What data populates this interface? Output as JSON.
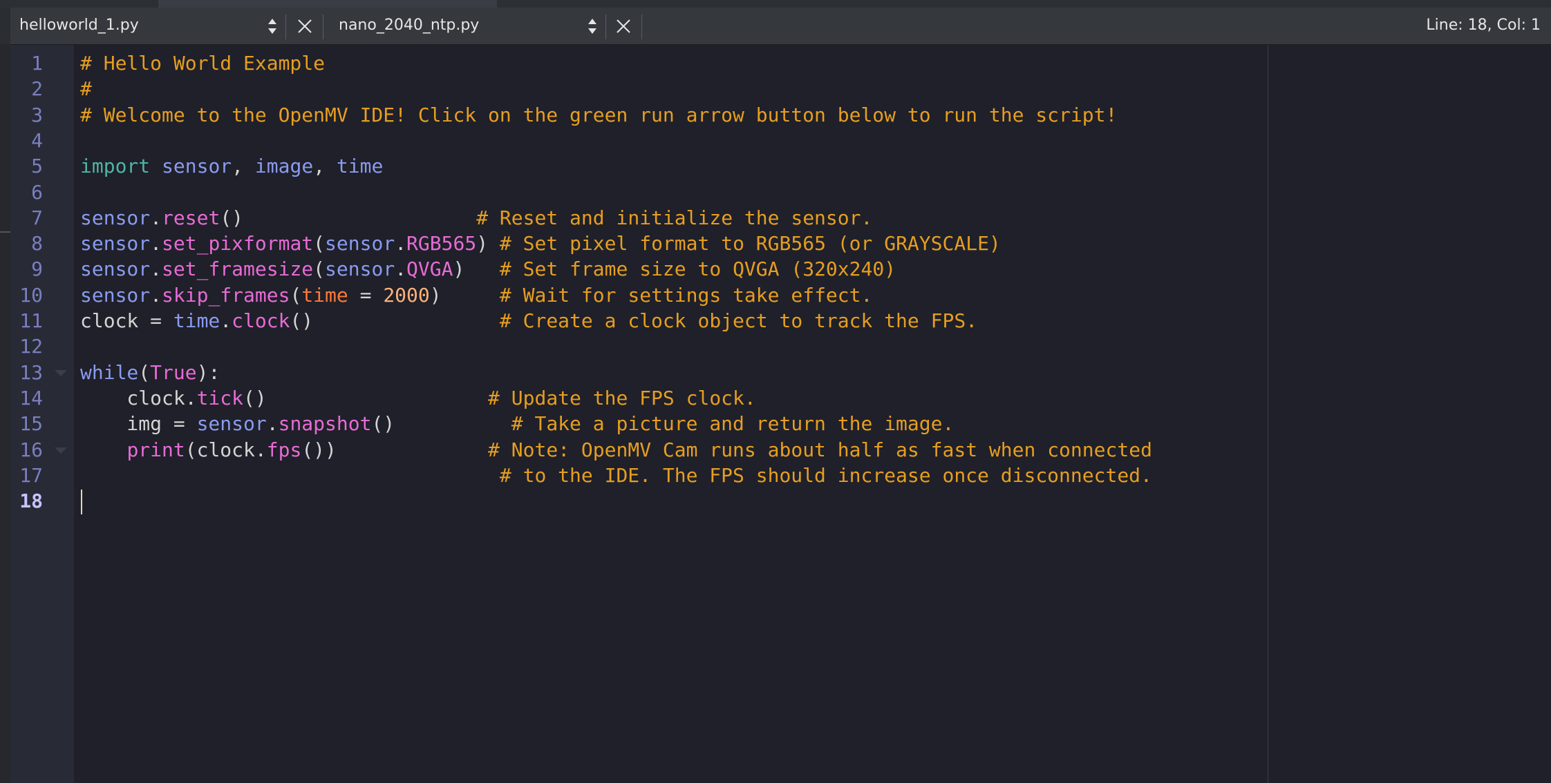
{
  "tabs": [
    {
      "label": "helloworld_1.py"
    },
    {
      "label": "nano_2040_ntp.py"
    }
  ],
  "status": "Line: 18, Col: 1",
  "line_numbers": [
    "1",
    "2",
    "3",
    "4",
    "5",
    "6",
    "7",
    "8",
    "9",
    "10",
    "11",
    "12",
    "13",
    "14",
    "15",
    "16",
    "17",
    "18"
  ],
  "current_line": "18",
  "code": [
    [
      {
        "t": "# Hello World Example",
        "c": "comment"
      }
    ],
    [
      {
        "t": "#",
        "c": "comment"
      }
    ],
    [
      {
        "t": "# Welcome to the OpenMV IDE! Click on the green run arrow button below to run the script!",
        "c": "comment"
      }
    ],
    [],
    [
      {
        "t": "import",
        "c": "kw"
      },
      {
        "t": " ",
        "c": "plain"
      },
      {
        "t": "sensor",
        "c": "mod"
      },
      {
        "t": ", ",
        "c": "plain"
      },
      {
        "t": "image",
        "c": "mod"
      },
      {
        "t": ", ",
        "c": "plain"
      },
      {
        "t": "time",
        "c": "mod"
      }
    ],
    [],
    [
      {
        "t": "sensor",
        "c": "mod"
      },
      {
        "t": ".",
        "c": "plain"
      },
      {
        "t": "reset",
        "c": "fn"
      },
      {
        "t": "()                    ",
        "c": "plain"
      },
      {
        "t": "# Reset and initialize the sensor.",
        "c": "comment"
      }
    ],
    [
      {
        "t": "sensor",
        "c": "mod"
      },
      {
        "t": ".",
        "c": "plain"
      },
      {
        "t": "set_pixformat",
        "c": "fn"
      },
      {
        "t": "(",
        "c": "plain"
      },
      {
        "t": "sensor",
        "c": "mod"
      },
      {
        "t": ".",
        "c": "plain"
      },
      {
        "t": "RGB565",
        "c": "const"
      },
      {
        "t": ") ",
        "c": "plain"
      },
      {
        "t": "# Set pixel format to RGB565 (or GRAYSCALE)",
        "c": "comment"
      }
    ],
    [
      {
        "t": "sensor",
        "c": "mod"
      },
      {
        "t": ".",
        "c": "plain"
      },
      {
        "t": "set_framesize",
        "c": "fn"
      },
      {
        "t": "(",
        "c": "plain"
      },
      {
        "t": "sensor",
        "c": "mod"
      },
      {
        "t": ".",
        "c": "plain"
      },
      {
        "t": "QVGA",
        "c": "const"
      },
      {
        "t": ")   ",
        "c": "plain"
      },
      {
        "t": "# Set frame size to QVGA (320x240)",
        "c": "comment"
      }
    ],
    [
      {
        "t": "sensor",
        "c": "mod"
      },
      {
        "t": ".",
        "c": "plain"
      },
      {
        "t": "skip_frames",
        "c": "fn"
      },
      {
        "t": "(",
        "c": "plain"
      },
      {
        "t": "time",
        "c": "arg"
      },
      {
        "t": " = ",
        "c": "plain"
      },
      {
        "t": "2000",
        "c": "num"
      },
      {
        "t": ")     ",
        "c": "plain"
      },
      {
        "t": "# Wait for settings take effect.",
        "c": "comment"
      }
    ],
    [
      {
        "t": "clock = ",
        "c": "plain"
      },
      {
        "t": "time",
        "c": "mod"
      },
      {
        "t": ".",
        "c": "plain"
      },
      {
        "t": "clock",
        "c": "fn"
      },
      {
        "t": "()                ",
        "c": "plain"
      },
      {
        "t": "# Create a clock object to track the FPS.",
        "c": "comment"
      }
    ],
    [],
    [
      {
        "t": "while",
        "c": "mod"
      },
      {
        "t": "(",
        "c": "plain"
      },
      {
        "t": "True",
        "c": "const"
      },
      {
        "t": "):",
        "c": "plain"
      }
    ],
    [
      {
        "t": "    clock.",
        "c": "plain"
      },
      {
        "t": "tick",
        "c": "fn"
      },
      {
        "t": "()                   ",
        "c": "plain"
      },
      {
        "t": "# Update the FPS clock.",
        "c": "comment"
      }
    ],
    [
      {
        "t": "    img = ",
        "c": "plain"
      },
      {
        "t": "sensor",
        "c": "mod"
      },
      {
        "t": ".",
        "c": "plain"
      },
      {
        "t": "snapshot",
        "c": "fn"
      },
      {
        "t": "()          ",
        "c": "plain"
      },
      {
        "t": "# Take a picture and return the image.",
        "c": "comment"
      }
    ],
    [
      {
        "t": "    ",
        "c": "plain"
      },
      {
        "t": "print",
        "c": "fn"
      },
      {
        "t": "(clock.",
        "c": "plain"
      },
      {
        "t": "fps",
        "c": "fn"
      },
      {
        "t": "())             ",
        "c": "plain"
      },
      {
        "t": "# Note: OpenMV Cam runs about half as fast when connected",
        "c": "comment"
      }
    ],
    [
      {
        "t": "                                    ",
        "c": "plain"
      },
      {
        "t": "# to the IDE. The FPS should increase once disconnected.",
        "c": "comment"
      }
    ],
    []
  ],
  "colors": {
    "background": "#1f2029",
    "gutter": "#282a36",
    "comment": "#e69e21",
    "keyword": "#4fb5a6",
    "module": "#8a9bf0",
    "function": "#e86bd6",
    "argument": "#ff7a3a",
    "number": "#ffb27a"
  }
}
